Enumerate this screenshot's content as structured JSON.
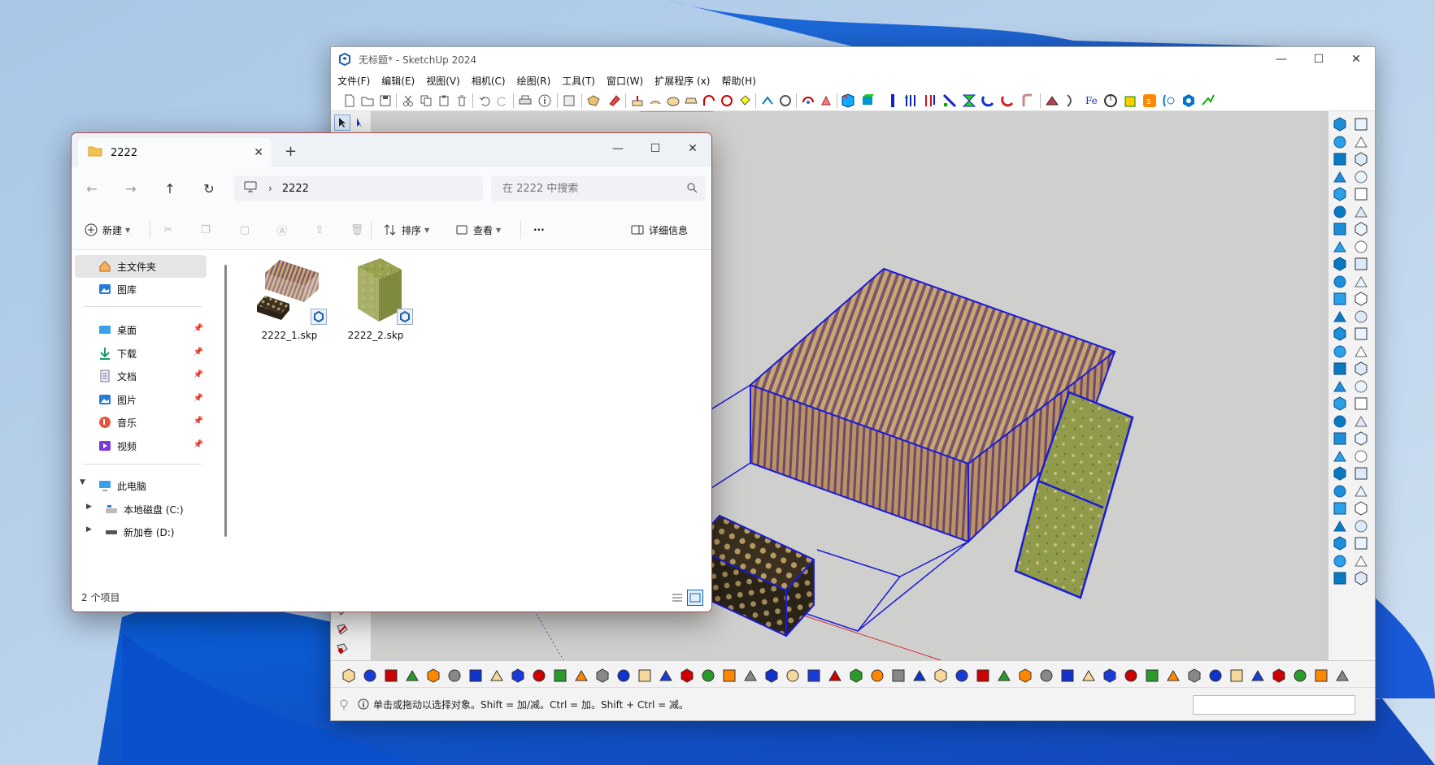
{
  "sketchup": {
    "title": "无标题* - SketchUp 2024",
    "menu": [
      "文件(F)",
      "编辑(E)",
      "视图(V)",
      "相机(C)",
      "绘图(R)",
      "工具(T)",
      "窗口(W)",
      "扩展程序 (x)",
      "帮助(H)"
    ],
    "status_text": "单击或拖动以选择对象。Shift = 加/减。Ctrl = 加。Shift + Ctrl = 减。",
    "measurements_value": ""
  },
  "explorer": {
    "tab_title": "2222",
    "breadcrumb": "2222",
    "search_placeholder": "在 2222 中搜索",
    "commands": {
      "new": "新建",
      "sort": "排序",
      "view": "查看",
      "more": "···",
      "details": "详细信息"
    },
    "nav": {
      "home": "主文件夹",
      "gallery": "图库",
      "desktop": "桌面",
      "downloads": "下载",
      "documents": "文档",
      "pictures": "图片",
      "music": "音乐",
      "videos": "视频",
      "this_pc": "此电脑",
      "drive_c": "本地磁盘 (C:)",
      "drive_d": "新加卷 (D:)"
    },
    "files": [
      {
        "name": "2222_1.skp"
      },
      {
        "name": "2222_2.skp"
      }
    ],
    "item_count": "2 个项目"
  },
  "colors": {
    "selection_blue": "#1a1adb",
    "accent": "#0067c0",
    "stripe_purple": "#7a5570",
    "stripe_tan": "#c9a870",
    "green_texture": "#8f9a4a"
  }
}
